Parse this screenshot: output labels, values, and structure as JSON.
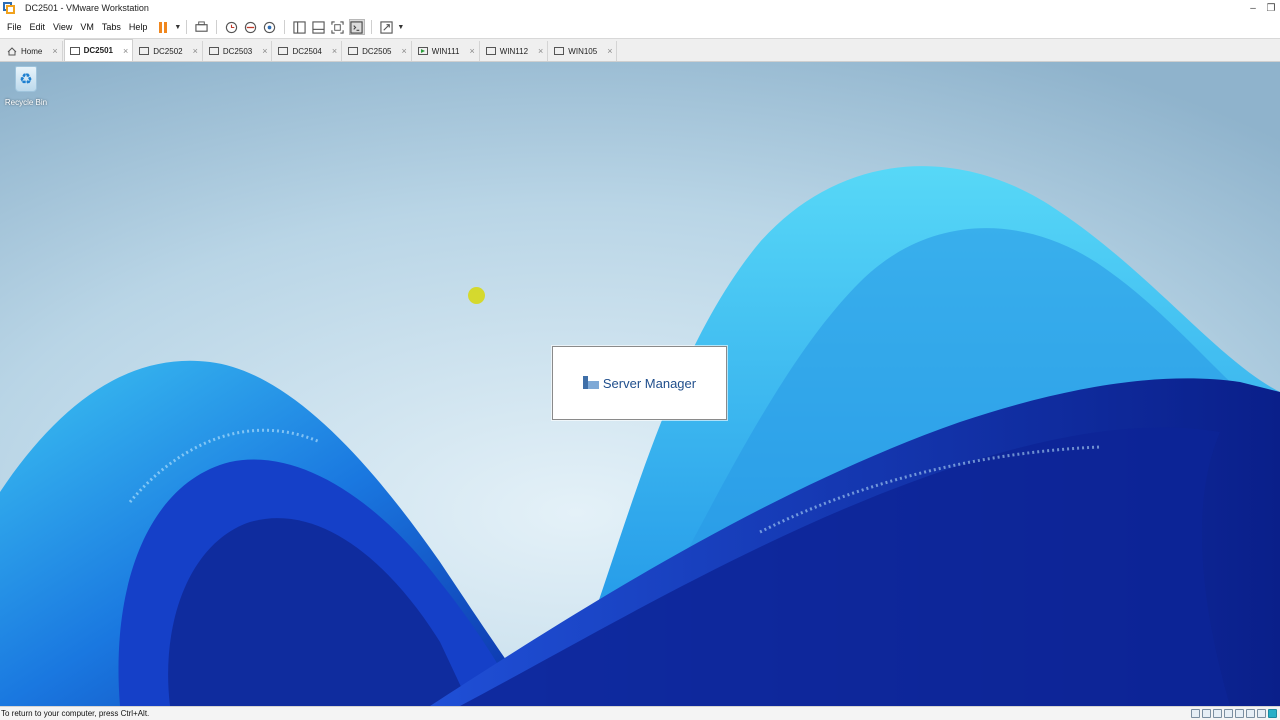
{
  "window": {
    "title": "DC2501 - VMware Workstation",
    "controls": [
      "–",
      "❐"
    ]
  },
  "menubar": {
    "items": [
      "File",
      "Edit",
      "View",
      "VM",
      "Tabs",
      "Help"
    ]
  },
  "tabs": [
    {
      "label": "Home",
      "icon": "home-icon",
      "active": false
    },
    {
      "label": "DC2501",
      "icon": "vm-icon",
      "active": true
    },
    {
      "label": "DC2502",
      "icon": "vm-icon",
      "active": false
    },
    {
      "label": "DC2503",
      "icon": "vm-icon",
      "active": false
    },
    {
      "label": "DC2504",
      "icon": "vm-icon",
      "active": false
    },
    {
      "label": "DC2505",
      "icon": "vm-icon",
      "active": false
    },
    {
      "label": "WIN111",
      "icon": "vm-running-icon",
      "active": false
    },
    {
      "label": "WIN112",
      "icon": "vm-icon",
      "active": false
    },
    {
      "label": "WIN105",
      "icon": "vm-icon",
      "active": false
    }
  ],
  "tab_close_glyph": "×",
  "desktop": {
    "recycle_bin_label": "Recycle Bin",
    "recycle_glyph": "♻"
  },
  "splash": {
    "title": "Server Manager"
  },
  "statusbar": {
    "text": "To return to your computer, press Ctrl+Alt."
  },
  "colors": {
    "accent": "#f0871e",
    "splash_text": "#1f4e8c",
    "wallpaper_blue": "#1a4fd8"
  }
}
